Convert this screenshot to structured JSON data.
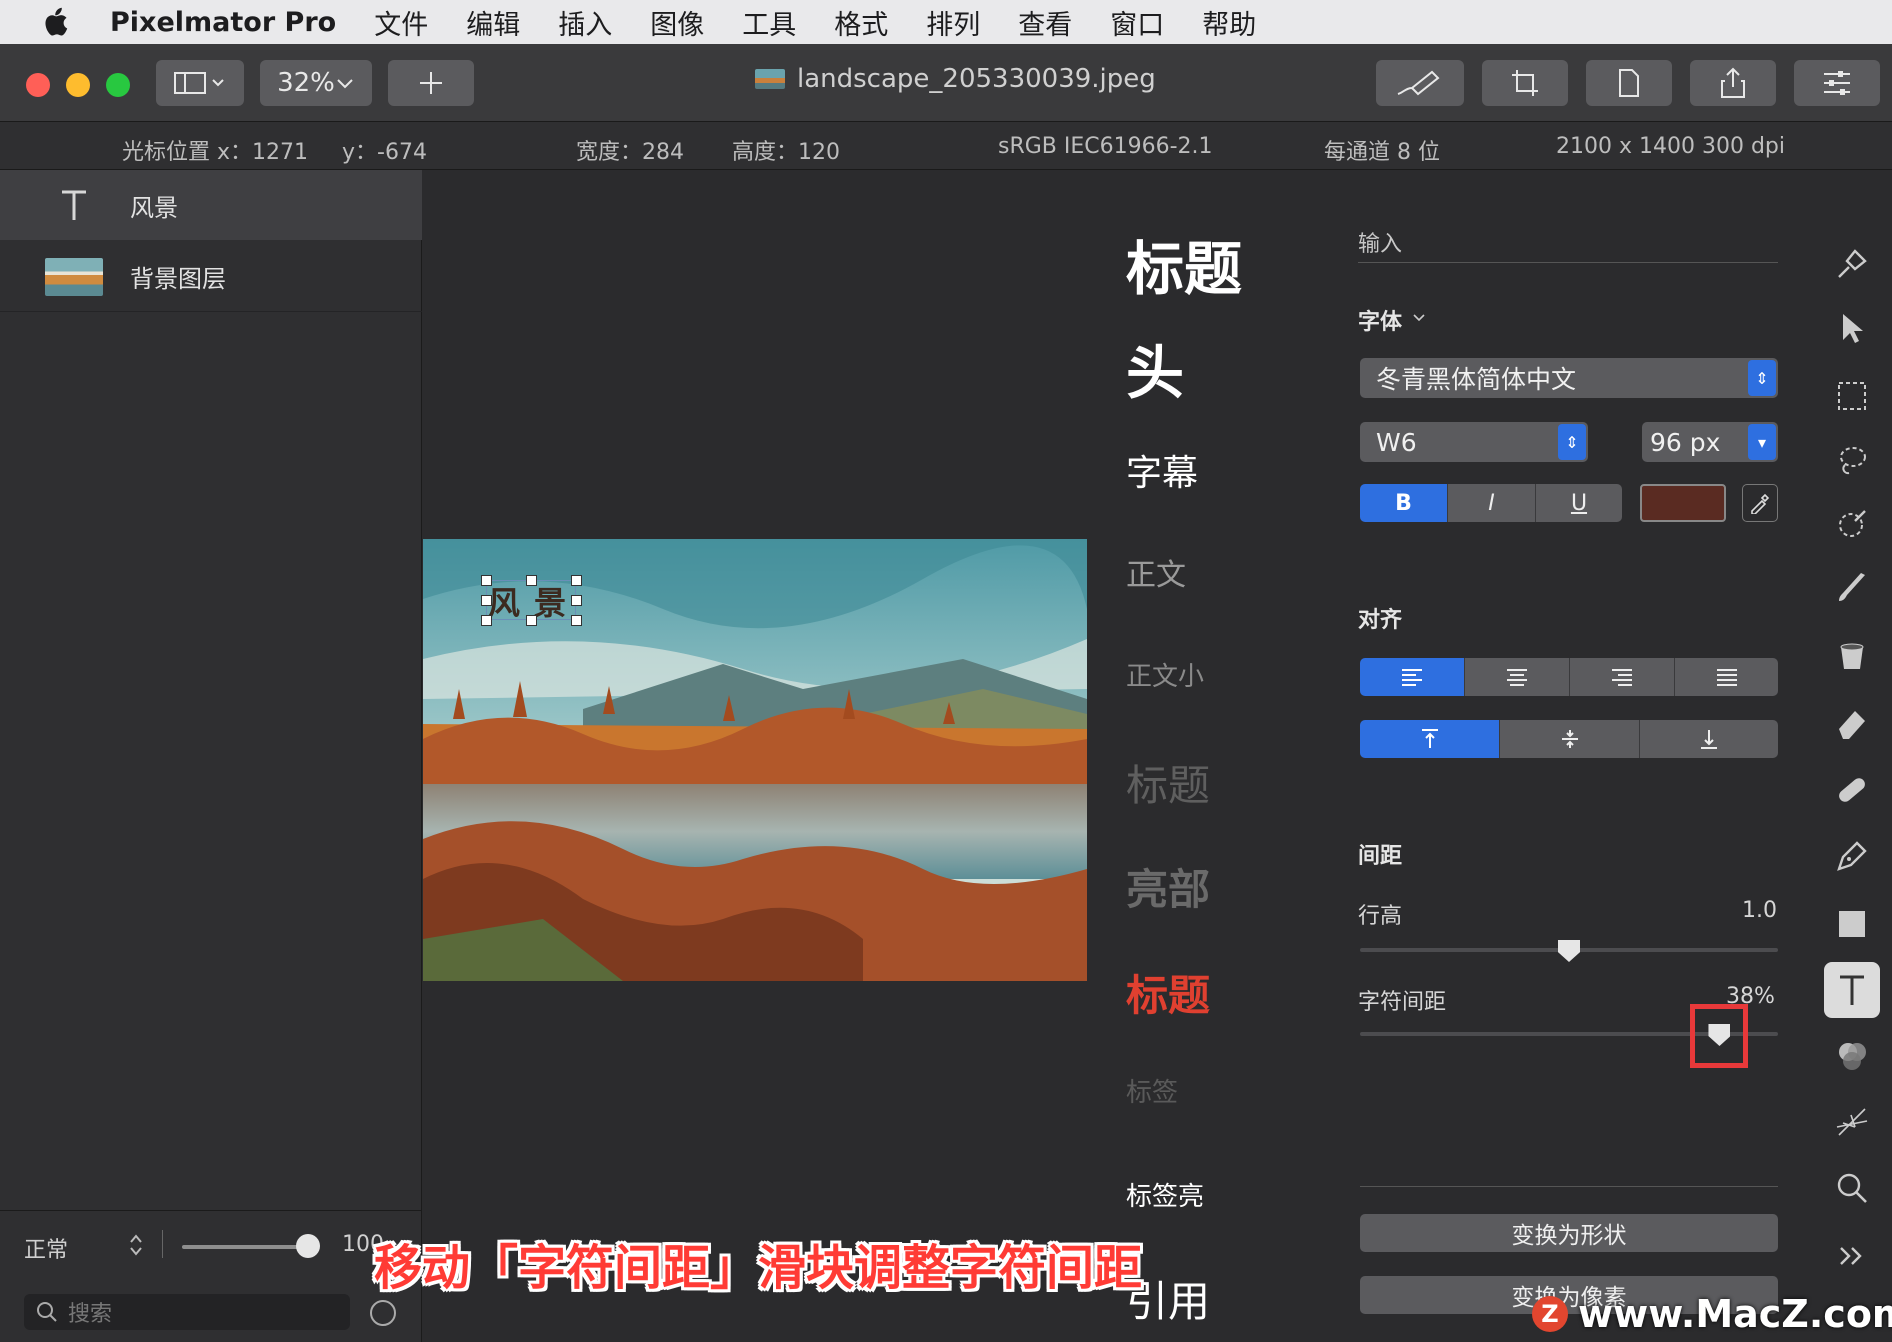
{
  "menubar": {
    "app_name": "Pixelmator Pro",
    "items": [
      "文件",
      "编辑",
      "插入",
      "图像",
      "工具",
      "格式",
      "排列",
      "查看",
      "窗口",
      "帮助"
    ]
  },
  "toolbar": {
    "zoom": "32%",
    "document_title": "landscape_205330039.jpeg"
  },
  "infobar": {
    "cursor_x": "光标位置 x：1271",
    "cursor_y": "y：-674",
    "width": "宽度：284",
    "height": "高度：120",
    "color_profile": "sRGB IEC61966-2.1",
    "bit_depth": "每通道 8 位",
    "dimensions": "2100 x 1400 300 dpi"
  },
  "layers": [
    {
      "name": "风景",
      "icon": "text-layer-icon"
    },
    {
      "name": "背景图层",
      "icon": "image-thumbnail"
    }
  ],
  "layers_footer": {
    "blend_mode": "正常",
    "opacity": "100",
    "search_placeholder": "搜索"
  },
  "canvas": {
    "text_layer_content": "风景"
  },
  "style_presets": [
    {
      "label": "标题",
      "color": "#ffffff"
    },
    {
      "label": "头",
      "color": "#ffffff"
    },
    {
      "label": "字幕",
      "color": "#ffffff"
    },
    {
      "label": "正文",
      "color": "#9a9a9a"
    },
    {
      "label": "正文小",
      "color": "#8a8a8a"
    },
    {
      "label": "标题",
      "color": "#5f5f5f"
    },
    {
      "label": "亮部",
      "color": "#6a6a6a"
    },
    {
      "label": "标题",
      "color": "#e04030"
    },
    {
      "label": "标签",
      "color": "#5a5a5a"
    },
    {
      "label": "标签亮",
      "color": "#ffffff"
    },
    {
      "label": "引用",
      "color": "#ffffff"
    }
  ],
  "inspector": {
    "input_label": "输入",
    "font_section": "字体",
    "font_family": "冬青黑体简体中文",
    "font_weight": "W6",
    "font_size": "96 px",
    "bold": "B",
    "italic": "I",
    "underline": "U",
    "text_color": "#5a2b22",
    "align_section": "对齐",
    "spacing_section": "间距",
    "line_height_label": "行高",
    "line_height_value": "1.0",
    "line_height_level": 0.5,
    "char_spacing_label": "字符间距",
    "char_spacing_value": "38%",
    "char_spacing_level": 0.86,
    "convert_shape": "变换为形状",
    "convert_pixels": "变换为像素"
  },
  "tools": [
    "brush-fill-icon",
    "arrow-pointer-icon",
    "rect-select-icon",
    "lasso-icon",
    "magic-select-icon",
    "paint-brush-icon",
    "paint-bucket-icon",
    "eraser-icon",
    "bandage-repair-icon",
    "pen-icon",
    "shape-icon",
    "text-tool-icon",
    "color-adjust-icon",
    "effects-icon",
    "zoom-icon",
    "more-tools-icon"
  ],
  "overlay": {
    "caption": "移动「字符间距」滑块调整字符间距",
    "watermark": "www.MacZ.com",
    "watermark_logo": "Z"
  },
  "colors": {
    "accent": "#2e6fe0",
    "highlight_box": "#e8393a"
  }
}
